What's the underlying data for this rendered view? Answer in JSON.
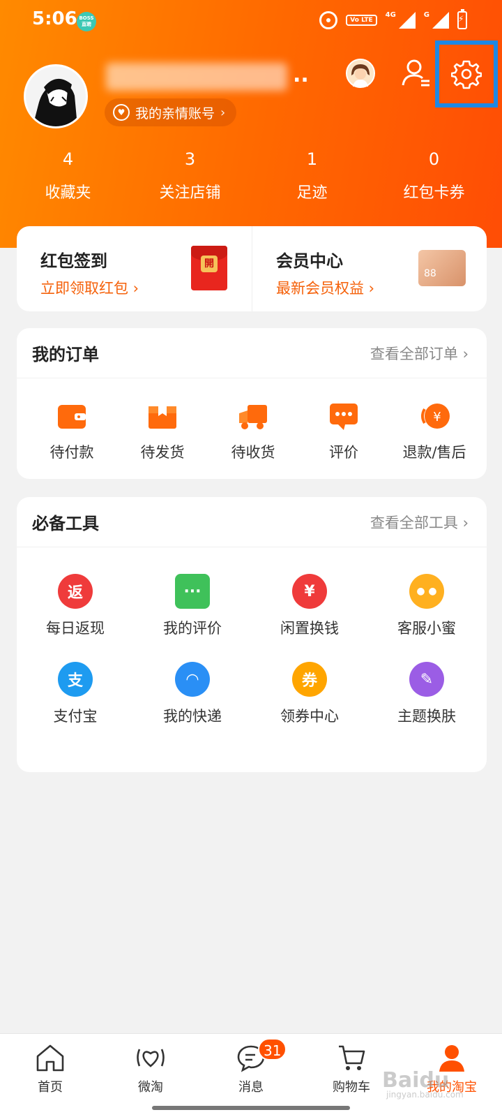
{
  "status_bar": {
    "time": "5:06",
    "boss_badge": "BOSS\n直聘",
    "net_label": "4G",
    "net_label_2": "G",
    "volte": "Vo LTE"
  },
  "profile": {
    "username_visible_tail": "..",
    "family_account": "我的亲情账号"
  },
  "stats": [
    {
      "count": "4",
      "label": "收藏夹"
    },
    {
      "count": "3",
      "label": "关注店铺"
    },
    {
      "count": "1",
      "label": "足迹"
    },
    {
      "count": "0",
      "label": "红包卡券"
    }
  ],
  "promos": {
    "red_packet": {
      "title": "红包签到",
      "subtitle": "立即领取红包 ›",
      "seal": "開"
    },
    "member": {
      "title": "会员中心",
      "subtitle": "最新会员权益 ›",
      "card_text": "88"
    }
  },
  "orders": {
    "title": "我的订单",
    "link": "查看全部订单 ›",
    "items": [
      {
        "label": "待付款",
        "icon": "wallet-icon"
      },
      {
        "label": "待发货",
        "icon": "package-icon"
      },
      {
        "label": "待收货",
        "icon": "truck-icon"
      },
      {
        "label": "评价",
        "icon": "comment-icon"
      },
      {
        "label": "退款/售后",
        "icon": "refund-icon"
      }
    ]
  },
  "tools": {
    "title": "必备工具",
    "link": "查看全部工具 ›",
    "items": [
      {
        "label": "每日返现",
        "glyph": "返",
        "color": "#ef3b3b"
      },
      {
        "label": "我的评价",
        "glyph": "···",
        "color": "#3fc15a"
      },
      {
        "label": "闲置换钱",
        "glyph": "¥",
        "color": "#ef3b3b"
      },
      {
        "label": "客服小蜜",
        "glyph": "● ●",
        "color": "#ffb020"
      },
      {
        "label": "支付宝",
        "glyph": "支",
        "color": "#1e9bf0"
      },
      {
        "label": "我的快递",
        "glyph": "◠",
        "color": "#2a8ff5"
      },
      {
        "label": "领券中心",
        "glyph": "券",
        "color": "#ffa500"
      },
      {
        "label": "主题换肤",
        "glyph": "✎",
        "color": "#9b5de5"
      }
    ]
  },
  "bottom_nav": [
    {
      "label": "首页",
      "icon": "home-icon"
    },
    {
      "label": "微淘",
      "icon": "weitao-icon"
    },
    {
      "label": "消息",
      "icon": "message-icon",
      "badge": "31"
    },
    {
      "label": "购物车",
      "icon": "cart-icon"
    },
    {
      "label": "我的淘宝",
      "icon": "profile-icon"
    }
  ],
  "watermark": {
    "brand": "Baidu",
    "site": "jingyan.baidu.com"
  }
}
